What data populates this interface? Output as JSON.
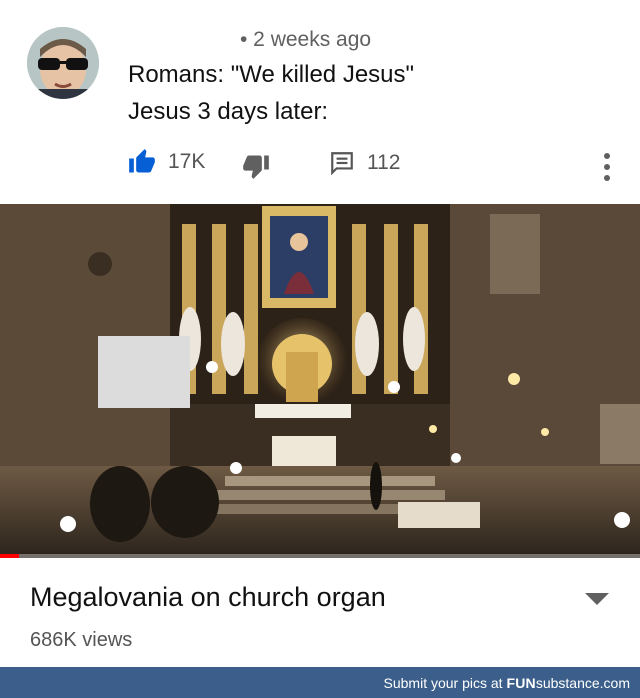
{
  "comment": {
    "avatar_icon": "user-avatar-sunglasses",
    "timestamp": "• 2 weeks ago",
    "lines": [
      "Romans: \"We killed Jesus\"",
      "Jesus 3 days later:"
    ],
    "likes": "17K",
    "replies": "112",
    "icons": {
      "like": "thumbs-up-icon",
      "dislike": "thumbs-down-icon",
      "reply": "reply-icon",
      "more": "more-vert-icon"
    },
    "like_color": "#065fd4"
  },
  "video": {
    "thumbnail": "church-organ-interior",
    "title": "Megalovania on church organ",
    "views": "686K views",
    "progress_fraction": 0.03,
    "progress_color": "#ff0000"
  },
  "footer": {
    "lead": "Submit your pics at ",
    "brand_bold": "FUN",
    "brand_rest": "substance.com",
    "bg": "#3b5f8a"
  }
}
